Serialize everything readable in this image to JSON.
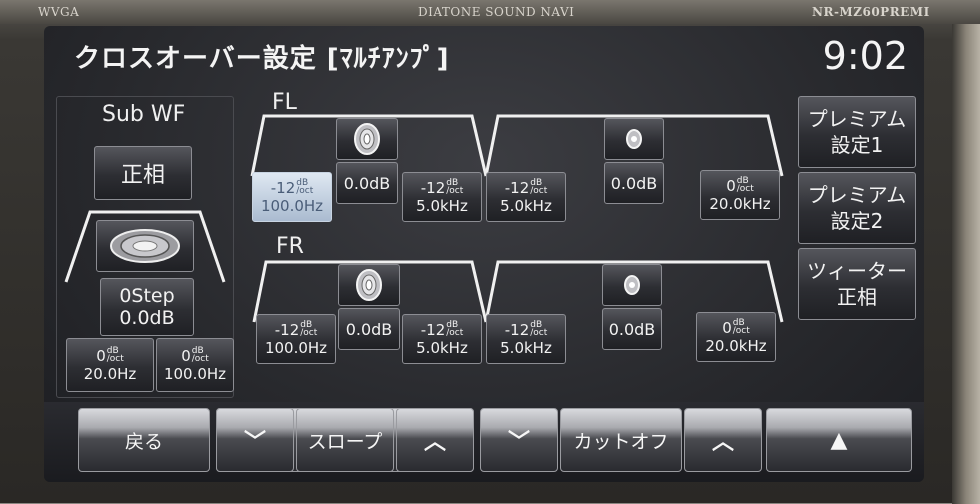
{
  "bezel": {
    "left_label": "WVGA",
    "center_label": "DIATONE SOUND NAVI",
    "right_label": "NR-MZ60PREMI"
  },
  "header": {
    "title": "クロスオーバー設定 [ﾏﾙﾁｱﾝﾌﾟ]",
    "clock": "9:02"
  },
  "subwf": {
    "title": "Sub WF",
    "phase_button": "正相",
    "level": {
      "step": "0Step",
      "db": "0.0dB"
    },
    "left_slope": {
      "value": "0",
      "unit_top": "dB",
      "unit_bot": "/oct",
      "freq": "20.0Hz"
    },
    "right_slope": {
      "value": "0",
      "unit_top": "dB",
      "unit_bot": "/oct",
      "freq": "100.0Hz"
    }
  },
  "fl": {
    "label": "FL",
    "woofer": {
      "hpf": {
        "value": "-12",
        "unit_top": "dB",
        "unit_bot": "/oct",
        "freq": "100.0Hz"
      },
      "gain": "0.0dB",
      "lpf": {
        "value": "-12",
        "unit_top": "dB",
        "unit_bot": "/oct",
        "freq": "5.0kHz"
      }
    },
    "tweeter": {
      "hpf": {
        "value": "-12",
        "unit_top": "dB",
        "unit_bot": "/oct",
        "freq": "5.0kHz"
      },
      "gain": "0.0dB",
      "lpf": {
        "value": "0",
        "unit_top": "dB",
        "unit_bot": "/oct",
        "freq": "20.0kHz"
      }
    }
  },
  "fr": {
    "label": "FR",
    "woofer": {
      "hpf": {
        "value": "-12",
        "unit_top": "dB",
        "unit_bot": "/oct",
        "freq": "100.0Hz"
      },
      "gain": "0.0dB",
      "lpf": {
        "value": "-12",
        "unit_top": "dB",
        "unit_bot": "/oct",
        "freq": "5.0kHz"
      }
    },
    "tweeter": {
      "hpf": {
        "value": "-12",
        "unit_top": "dB",
        "unit_bot": "/oct",
        "freq": "5.0kHz"
      },
      "gain": "0.0dB",
      "lpf": {
        "value": "0",
        "unit_top": "dB",
        "unit_bot": "/oct",
        "freq": "20.0kHz"
      }
    }
  },
  "right_panel": {
    "premium1_line1": "プレミアム",
    "premium1_line2": "設定1",
    "premium2_line1": "プレミアム",
    "premium2_line2": "設定2",
    "tweeter_line1": "ツィーター",
    "tweeter_line2": "正相"
  },
  "bottom": {
    "back": "戻る",
    "slope_down": "﹀",
    "slope": "スロープ",
    "slope_up": "︿",
    "cutoff_down": "﹀",
    "cutoff": "カットオフ",
    "cutoff_up": "︿",
    "up_arrow": "▲"
  },
  "icons": {
    "woofer": "woofer-speaker-icon",
    "tweeter": "tweeter-speaker-icon",
    "sub": "subwoofer-icon"
  }
}
